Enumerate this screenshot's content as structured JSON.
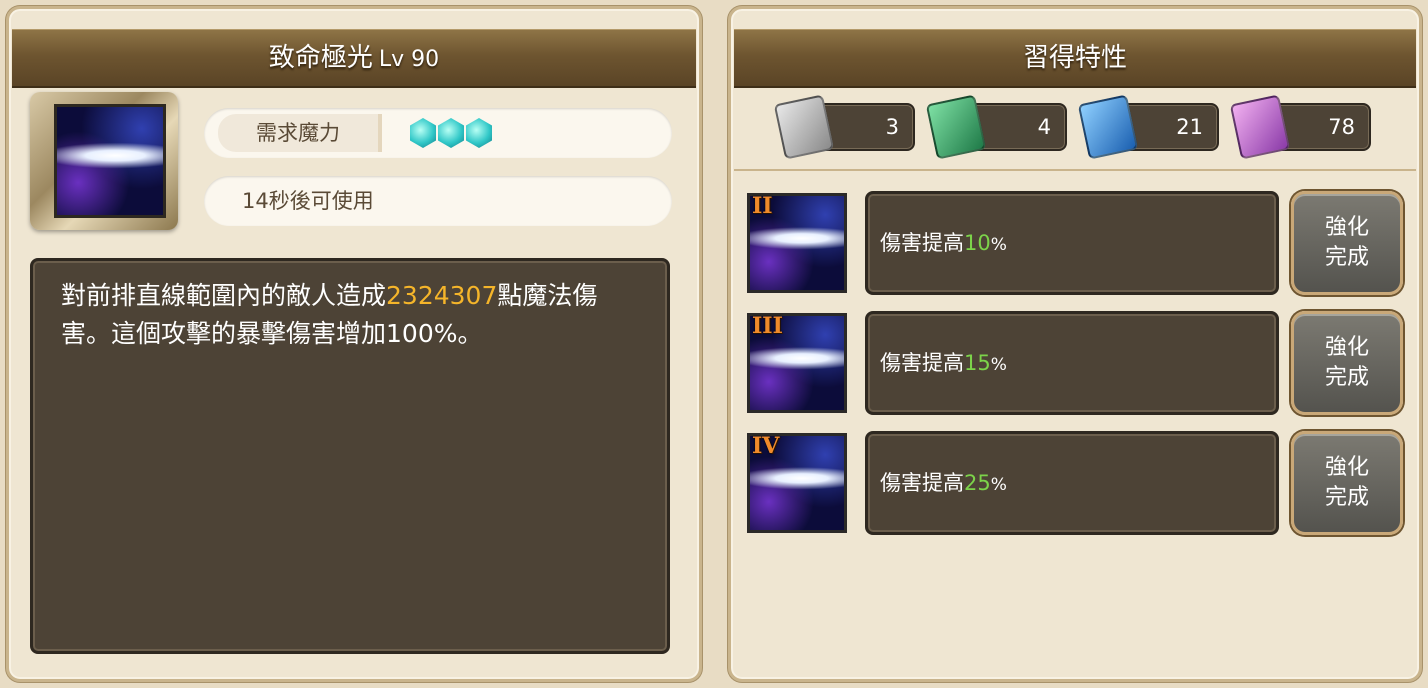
{
  "skill": {
    "name": "致命極光",
    "level": "Lv 90",
    "mana_label": "需求魔力",
    "mana_cost": 3,
    "cooldown_text": "14秒後可使用",
    "description_pre": "對前排直線範圍內的敵人造成",
    "description_damage": "2324307",
    "description_post": "點魔法傷害。這個攻擊的暴擊傷害增加100%。"
  },
  "traits_panel": {
    "title": "習得特性",
    "book_counts": [
      {
        "icon": "gray-book-icon",
        "color": "#b8b8b8",
        "count": "3"
      },
      {
        "icon": "green-book-icon",
        "color": "#3aa86a",
        "count": "4"
      },
      {
        "icon": "blue-book-icon",
        "color": "#2e86d8",
        "count": "21"
      },
      {
        "icon": "purple-book-icon",
        "color": "#c07ad8",
        "count": "78"
      }
    ],
    "traits": [
      {
        "rank": "II",
        "text": "傷害提高",
        "value": "10",
        "unit": "%",
        "button": "強化\n完成"
      },
      {
        "rank": "III",
        "text": "傷害提高",
        "value": "15",
        "unit": "%",
        "button": "強化\n完成"
      },
      {
        "rank": "IV",
        "text": "傷害提高",
        "value": "25",
        "unit": "%",
        "button": "強化\n完成"
      }
    ]
  },
  "colors": {
    "highlight": "#f5b52a",
    "percent": "#7cd34a",
    "header_bg": "#6e5530"
  }
}
